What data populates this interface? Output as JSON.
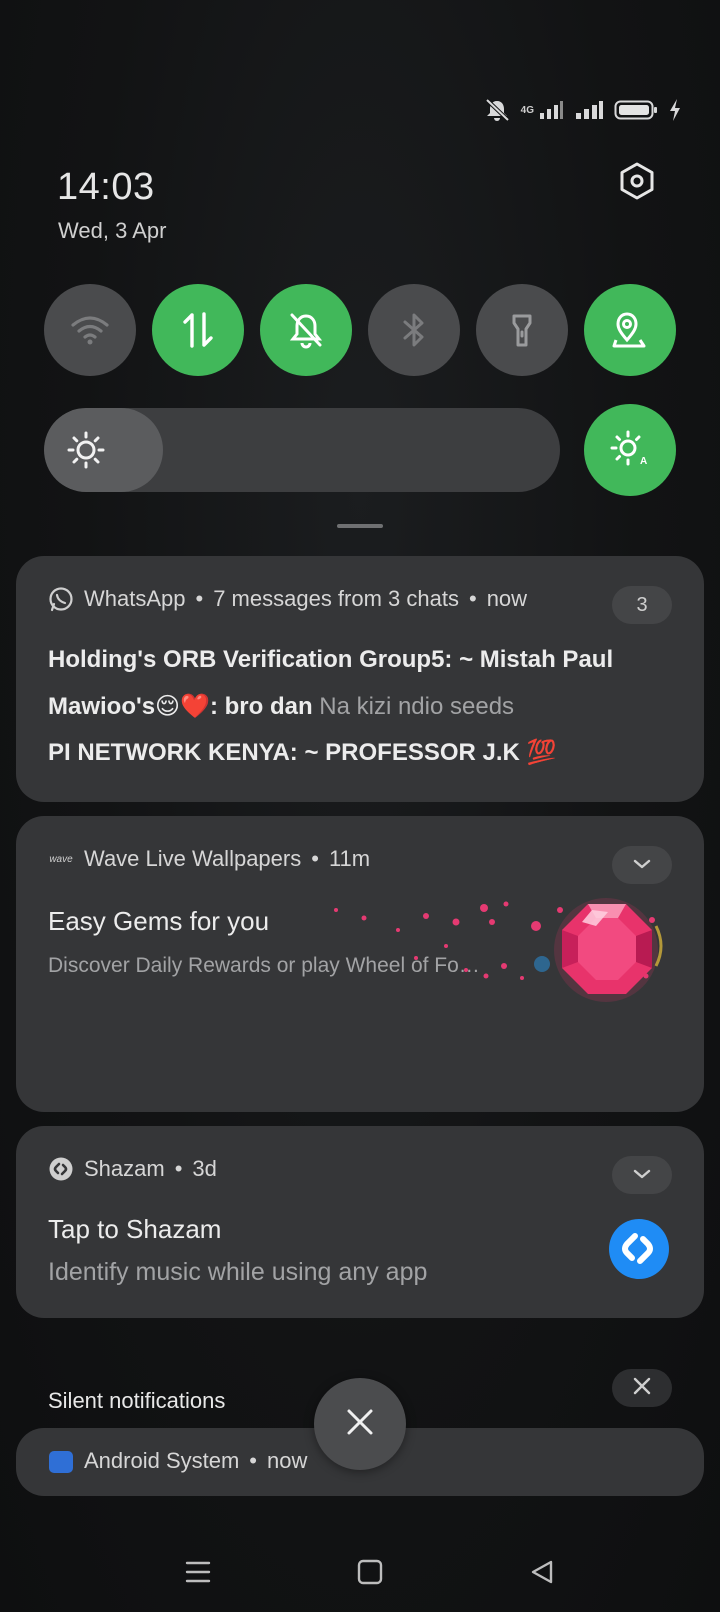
{
  "status_bar": {
    "network_label": "4G",
    "icons": [
      "mute-icon",
      "signal-4g-icon",
      "signal-icon",
      "battery-icon",
      "charging-icon"
    ]
  },
  "header": {
    "time": "14:03",
    "date": "Wed, 3 Apr",
    "settings_icon": "gear-hexagon-icon"
  },
  "quick_tiles": [
    {
      "name": "wifi",
      "icon": "wifi-icon",
      "on": false
    },
    {
      "name": "mobile-data",
      "icon": "mobile-data-icon",
      "on": true
    },
    {
      "name": "do-not-disturb",
      "icon": "bell-off-icon",
      "on": true
    },
    {
      "name": "bluetooth",
      "icon": "bluetooth-icon",
      "on": false
    },
    {
      "name": "flashlight",
      "icon": "flashlight-icon",
      "on": false
    },
    {
      "name": "location",
      "icon": "location-icon",
      "on": true
    }
  ],
  "brightness": {
    "level": 0.23,
    "icon": "sun-icon",
    "auto_icon": "auto-brightness-icon"
  },
  "notifications": [
    {
      "app": "WhatsApp",
      "summary": "7 messages from 3 chats",
      "time": "now",
      "count": "3",
      "lines": [
        {
          "sender": "Holding's ORB Verification Group5: ~ Mistah Paul",
          "text": ""
        },
        {
          "sender": "Mawioo's😌❤️: bro dan",
          "text": " Na kizi ndio seeds"
        },
        {
          "sender": "PI NETWORK KENYA: ~ PROFESSOR J.K 💯",
          "text": ""
        }
      ]
    },
    {
      "app": "Wave Live Wallpapers",
      "app_icon_text": "wave",
      "time": "11m",
      "title": "Easy Gems for you",
      "body": "Discover Daily Rewards or play Wheel of Fo…"
    },
    {
      "app": "Shazam",
      "time": "3d",
      "title": "Tap to Shazam",
      "body": "Identify music while using any app"
    }
  ],
  "silent": {
    "label": "Silent notifications",
    "app": "Android System",
    "time": "now"
  },
  "separator": "•",
  "colors": {
    "accent": "#41b85a",
    "tile_off": "#4a4b4d",
    "card": "#353638",
    "shazam": "#1f8cf5"
  }
}
